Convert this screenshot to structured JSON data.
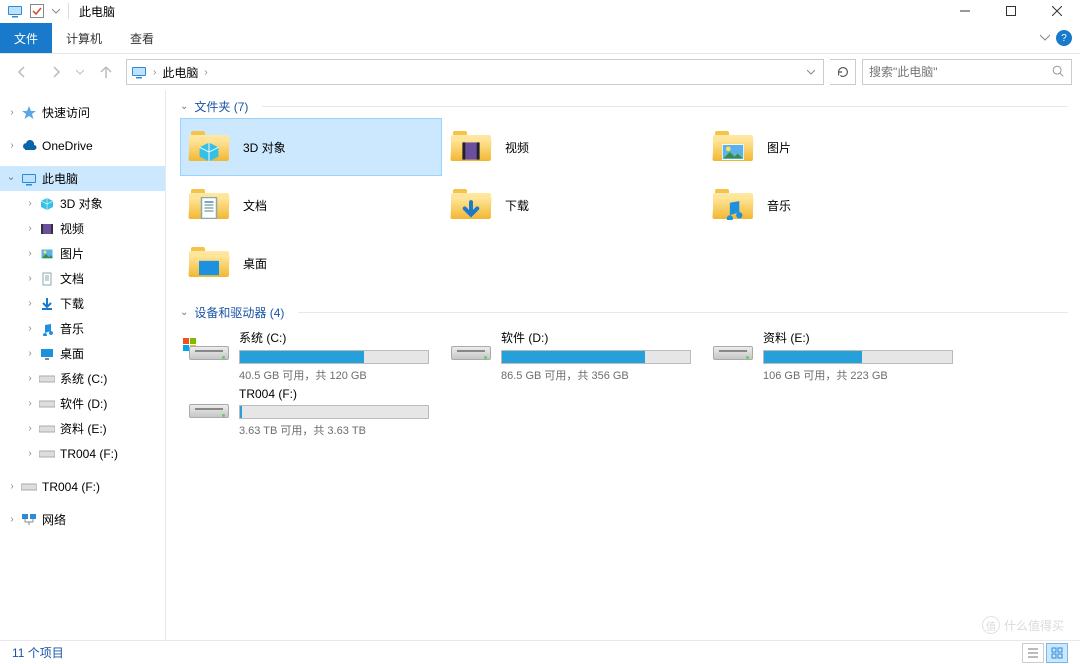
{
  "window": {
    "title": "此电脑"
  },
  "ribbon": {
    "file": "文件",
    "computer": "计算机",
    "view": "查看"
  },
  "address": {
    "segment": "此电脑"
  },
  "search": {
    "placeholder": "搜索\"此电脑\""
  },
  "sidebar": {
    "quick_access": "快速访问",
    "onedrive": "OneDrive",
    "this_pc": "此电脑",
    "children": {
      "3d": "3D 对象",
      "videos": "视频",
      "pictures": "图片",
      "documents": "文档",
      "downloads": "下载",
      "music": "音乐",
      "desktop": "桌面",
      "c": "系统 (C:)",
      "d": "软件 (D:)",
      "e": "资料 (E:)",
      "f": "TR004 (F:)"
    },
    "tr004_ext": "TR004 (F:)",
    "network": "网络"
  },
  "groups": {
    "folders": "文件夹 (7)",
    "drives": "设备和驱动器 (4)"
  },
  "folders": {
    "f0": "3D 对象",
    "f1": "视频",
    "f2": "图片",
    "f3": "文档",
    "f4": "下载",
    "f5": "音乐",
    "f6": "桌面"
  },
  "drives": [
    {
      "name": "系统 (C:)",
      "text": "40.5 GB 可用，共 120 GB",
      "fill": 66,
      "os": true
    },
    {
      "name": "软件 (D:)",
      "text": "86.5 GB 可用，共 356 GB",
      "fill": 76
    },
    {
      "name": "资料 (E:)",
      "text": "106 GB 可用，共 223 GB",
      "fill": 52
    },
    {
      "name": "TR004 (F:)",
      "text": "3.63 TB 可用，共 3.63 TB",
      "fill": 1
    }
  ],
  "status": {
    "items": "11 个项目"
  },
  "watermark": "什么值得买"
}
